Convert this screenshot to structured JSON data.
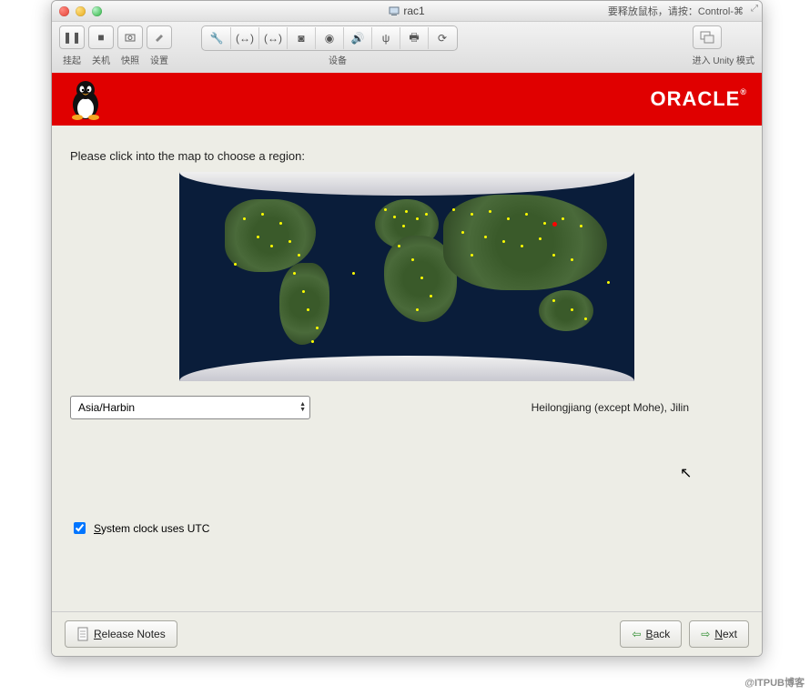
{
  "window": {
    "title": "rac1",
    "hint_text": "要释放鼠标，请按：Control-⌘"
  },
  "toolbar": {
    "suspend": "挂起",
    "shutdown": "关机",
    "snapshot": "快照",
    "settings": "设置",
    "devices": "设备",
    "unity": "进入 Unity 模式"
  },
  "header": {
    "brand": "ORACLE"
  },
  "content": {
    "prompt": "Please click into the map to choose a region:",
    "timezone": "Asia/Harbin",
    "region_desc": "Heilongjiang (except Mohe), Jilin",
    "utc_label": "System clock uses UTC",
    "utc_checked": true
  },
  "footer": {
    "release_notes": "Release Notes",
    "back": "Back",
    "next": "Next"
  },
  "watermark": "@ITPUB博客"
}
